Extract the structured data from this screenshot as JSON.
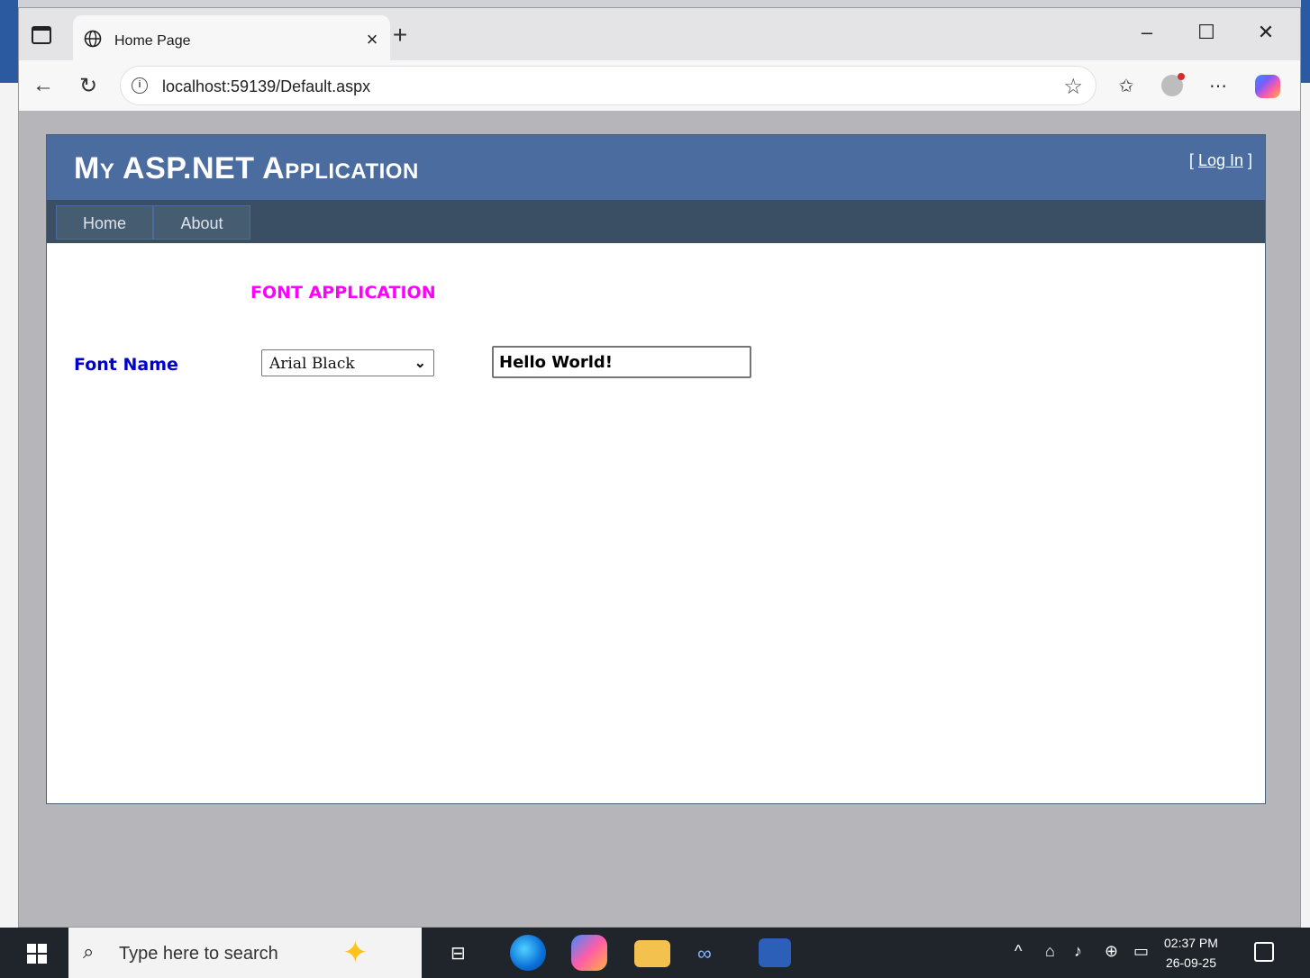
{
  "browser": {
    "tab_title": "Home Page",
    "url": "localhost:59139/Default.aspx",
    "new_tab_symbol": "+",
    "tab_close_symbol": "×",
    "window_controls": [
      "–",
      "☐",
      "✕"
    ]
  },
  "site": {
    "title": "My ASP.NET Application",
    "login_open": "[ ",
    "login_link": "Log In",
    "login_close": " ]",
    "menu": [
      {
        "label": "Home"
      },
      {
        "label": "About"
      }
    ]
  },
  "form": {
    "heading": "FONT APPLICATION",
    "font_label": "Font Name",
    "font_select_value": "Arial Black",
    "preview_text": "Hello World!"
  },
  "taskbar": {
    "search_placeholder": "Type here to search",
    "time": "02:37 PM",
    "date": "26-09-25"
  },
  "colors": {
    "header": "#4b6c9e",
    "menubar": "#3a4f63",
    "heading": "#ff00ff",
    "label": "#0000cc"
  }
}
